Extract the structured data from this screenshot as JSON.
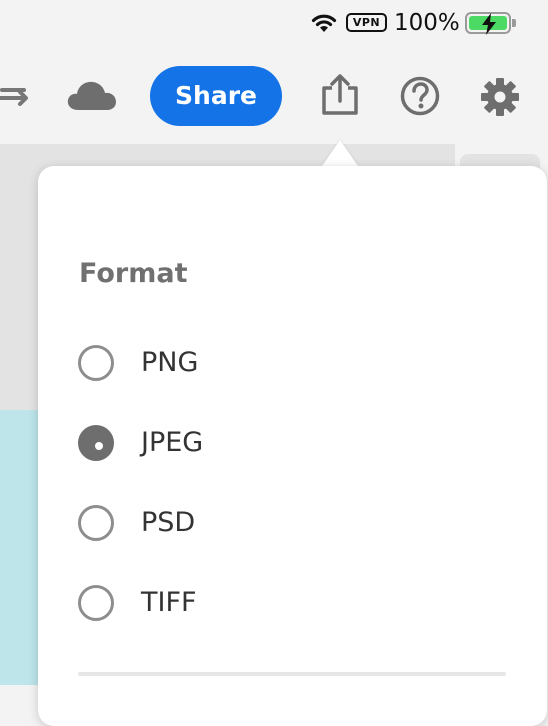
{
  "status_bar": {
    "vpn_label": "VPN",
    "battery_percent": "100%",
    "battery_level": 1.0,
    "battery_color": "#4cd964",
    "icons": [
      "wifi-icon",
      "battery-icon",
      "charging-bolt-icon"
    ]
  },
  "toolbar": {
    "share_label": "Share",
    "share_color": "#1473e6",
    "icons": [
      "redo-icon",
      "cloud-icon",
      "export-icon",
      "help-icon",
      "gear-icon"
    ]
  },
  "format_popover": {
    "title": "Format",
    "options": [
      {
        "label": "PNG",
        "selected": false
      },
      {
        "label": "JPEG",
        "selected": true
      },
      {
        "label": "PSD",
        "selected": false
      },
      {
        "label": "TIFF",
        "selected": false
      }
    ]
  }
}
